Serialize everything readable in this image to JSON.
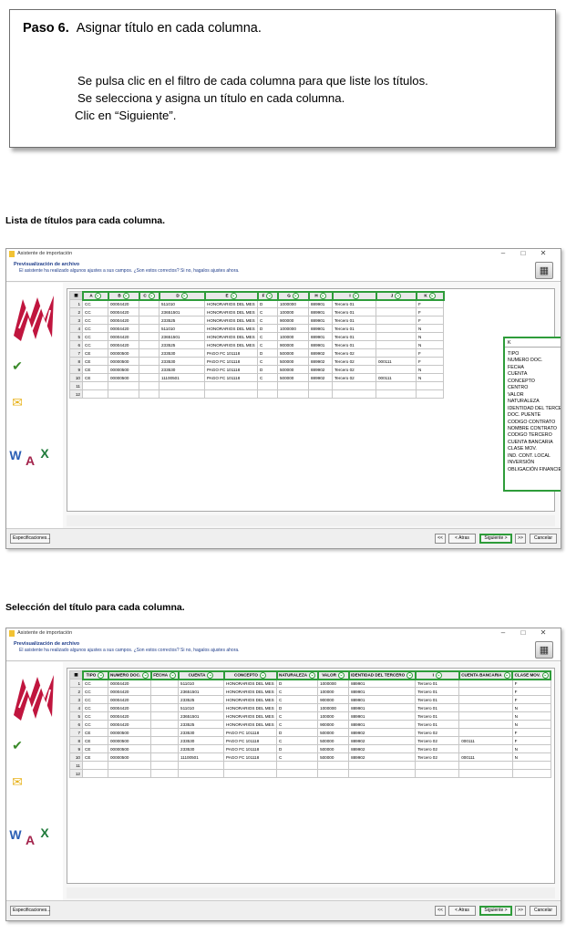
{
  "instructions": {
    "step_label": "Paso 6.",
    "step_title": "Asignar título en cada columna.",
    "lines": [
      "Se pulsa clic en el filtro de cada columna para que liste los títulos.",
      "Se selecciona y asigna un título en cada columna.",
      "Clic en “Siguiente”."
    ]
  },
  "section1_title": "Lista de títulos para cada columna.",
  "section2_title": "Selección del título para cada columna.",
  "wizard": {
    "window_title": "Asistente de importación",
    "preview_title": "Previsualización de archivo",
    "preview_subtitle": "El asistente ha realizado algunos ajustes a sus campos. ¿Son estos correctos? Si no, hagalos ajustes ahora.",
    "row_numbers": [
      "1",
      "2",
      "3",
      "4",
      "5",
      "6",
      "7",
      "8",
      "9",
      "10",
      "11",
      "12"
    ],
    "rows": [
      [
        "CC",
        "00004420",
        "",
        "511010",
        "HONORARIOS DEL MES",
        "D",
        "1000000",
        "889901",
        "Tercero 01",
        "",
        "F"
      ],
      [
        "CC",
        "00004420",
        "",
        "23651501",
        "HONORARIOS DEL MES",
        "C",
        "100000",
        "889901",
        "Tercero 01",
        "",
        "F"
      ],
      [
        "CC",
        "00004420",
        "",
        "233525",
        "HONORARIOS DEL MES",
        "C",
        "900000",
        "889901",
        "Tercero 01",
        "",
        "F"
      ],
      [
        "CC",
        "00004420",
        "",
        "511010",
        "HONORARIOS DEL MES",
        "D",
        "1000000",
        "889901",
        "Tercero 01",
        "",
        "N"
      ],
      [
        "CC",
        "00004420",
        "",
        "23651501",
        "HONORARIOS DEL MES",
        "C",
        "100000",
        "889901",
        "Tercero 01",
        "",
        "N"
      ],
      [
        "CC",
        "00004420",
        "",
        "233525",
        "HONORARIOS DEL MES",
        "C",
        "900000",
        "889901",
        "Tercero 01",
        "",
        "N"
      ],
      [
        "CE",
        "00000500",
        "",
        "233530",
        "PAGO FC 101118",
        "D",
        "500000",
        "889902",
        "Tercero 02",
        "",
        "F"
      ],
      [
        "CE",
        "00000500",
        "",
        "233530",
        "PAGO FC 101118",
        "C",
        "500000",
        "889902",
        "Tercero 02",
        "000111",
        "F"
      ],
      [
        "CE",
        "00000500",
        "",
        "233530",
        "PAGO FC 101118",
        "D",
        "500000",
        "889902",
        "Tercero 02",
        "",
        "N"
      ],
      [
        "CE",
        "00000500",
        "",
        "11100501",
        "PAGO FC 101118",
        "C",
        "500000",
        "889902",
        "Tercero 02",
        "000111",
        "N"
      ]
    ],
    "letter_headers": [
      "A",
      "B",
      "C",
      "D",
      "E",
      "F",
      "G",
      "H",
      "I",
      "J",
      "K"
    ],
    "named_headers": [
      "TIPO",
      "NUMERO DOC.",
      "FECHA",
      "CUENTA",
      "CONCEPTO",
      "NATURALEZA",
      "VALOR",
      "IDENTIDAD DEL TERCERO",
      "I",
      "CUENTA BANCARIA",
      "CLASE MOV."
    ],
    "dropdown_selected": "K",
    "dropdown_options": [
      "TIPO",
      "NUMERO DOC.",
      "FECHA",
      "CUENTA",
      "CONCEPTO",
      "CENTRO",
      "VALOR",
      "NATURALEZA",
      "IDENTIDAD DEL TERCERO",
      "DOC. PUENTE",
      "CODIGO CONTRATO",
      "NOMBRE CONTRATO",
      "CODIGO TERCERO",
      "CUENTA BANCARIA",
      "CLASE MOV.",
      "IND. CONT. LOCAL",
      "INVERSIÓN",
      "OBLIGACIÓN FINANCIERA"
    ],
    "buttons": {
      "specs": "Especificaciones...",
      "first": "<<",
      "back": "< Atras",
      "next": "Siguiente >",
      "last": ">>",
      "cancel": "Cancelar"
    },
    "window_controls": [
      "–",
      "□",
      "✕"
    ]
  },
  "colors": {
    "accent_green": "#2e9c3a",
    "logo_red": "#c0153e",
    "header_blue": "#1f3d8a"
  }
}
